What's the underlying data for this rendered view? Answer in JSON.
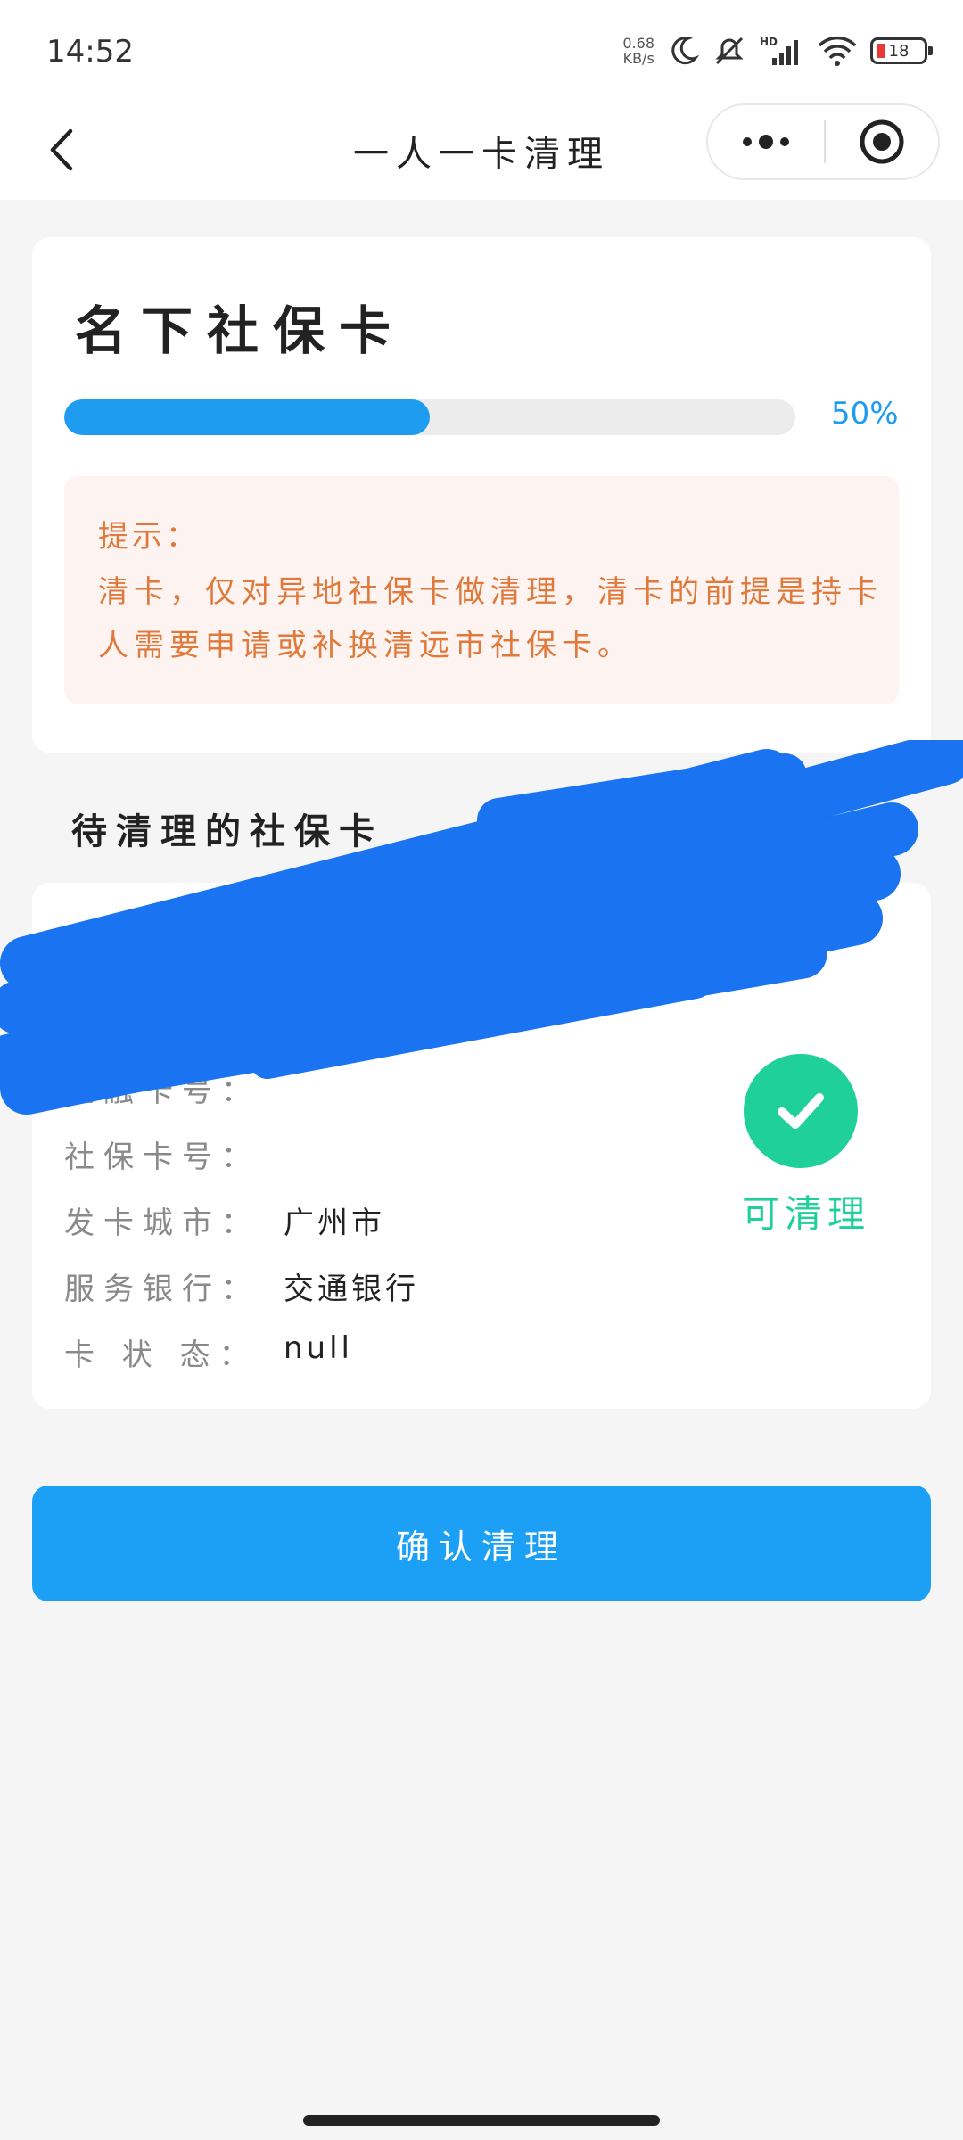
{
  "status_bar": {
    "time": "14:52",
    "net_speed_value": "0.68",
    "net_speed_unit": "KB/s",
    "battery": "18",
    "icons": [
      "moon-icon",
      "mute-icon",
      "signal-icon",
      "wifi-icon",
      "battery-icon"
    ]
  },
  "nav": {
    "title": "一人一卡清理"
  },
  "card": {
    "title": "名下社保卡",
    "progress": 0.5,
    "progress_label": "50%",
    "tip_label": "提示：",
    "tip_text": "清卡，仅对异地社保卡做清理，清卡的前提是持卡人需要申请或补换清远市社保卡。"
  },
  "pending": {
    "section_title": "待清理的社保卡",
    "rows": [
      {
        "label": "金融卡号：",
        "value": ""
      },
      {
        "label": "社保卡号：",
        "value": ""
      },
      {
        "label": "发卡城市：",
        "value": "广州市"
      },
      {
        "label": "服务银行：",
        "value": "交通银行"
      },
      {
        "label": "卡  状  态：",
        "value": "null"
      }
    ],
    "status_text": "可清理"
  },
  "actions": {
    "confirm_label": "确认清理"
  },
  "colors": {
    "accent": "#1ba0f5",
    "success": "#1fd09a",
    "tip_text": "#e07a3c",
    "tip_bg": "#fdf3f0",
    "redaction": "#1a73f0"
  }
}
